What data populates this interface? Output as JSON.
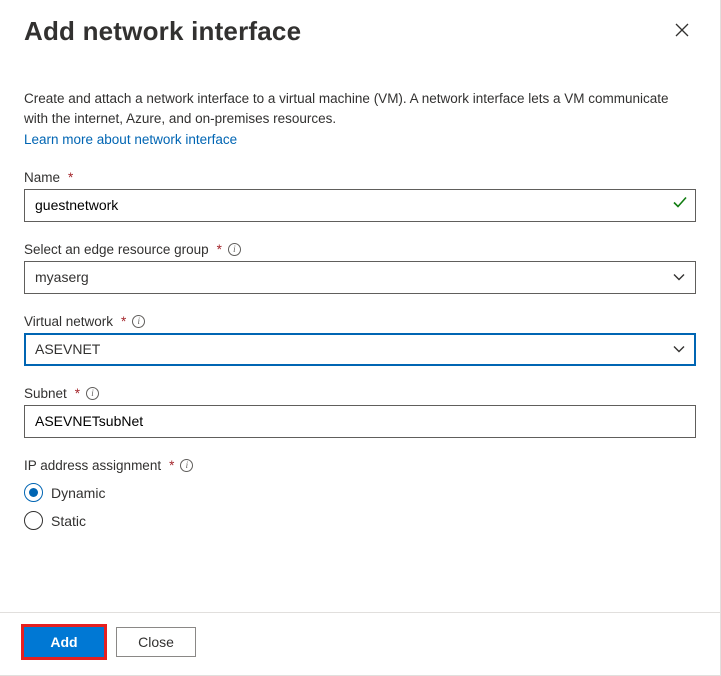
{
  "header": {
    "title": "Add network interface"
  },
  "description": {
    "text": "Create and attach a network interface to a virtual machine (VM). A network interface lets a VM communicate with the internet, Azure, and on-premises resources.",
    "link": "Learn more about network interface"
  },
  "fields": {
    "name": {
      "label": "Name",
      "value": "guestnetwork"
    },
    "resourceGroup": {
      "label": "Select an edge resource group",
      "value": "myaserg"
    },
    "vnet": {
      "label": "Virtual network",
      "value": "ASEVNET"
    },
    "subnet": {
      "label": "Subnet",
      "value": "ASEVNETsubNet"
    },
    "ipAssign": {
      "label": "IP address assignment",
      "options": {
        "dynamic": "Dynamic",
        "static": "Static"
      },
      "selected": "dynamic"
    }
  },
  "buttons": {
    "add": "Add",
    "close": "Close"
  }
}
